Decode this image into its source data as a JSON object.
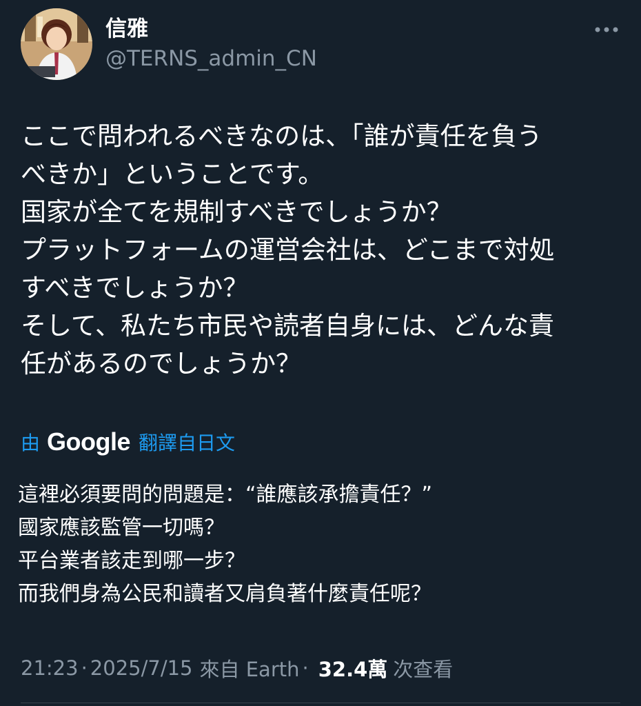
{
  "author": {
    "display_name": "信雅",
    "handle": "@TERNS_admin_CN"
  },
  "tweet": {
    "text": "ここで問われるべきなのは、「誰が責任を負う\nべきか」ということです。\n国家が全てを規制すべきでしょうか？\nプラットフォームの運営会社は、どこまで対処\nすべきでしょうか？\nそして、私たち市民や読者自身には、どんな責\n任があるのでしょうか？"
  },
  "translation": {
    "by_label": "由",
    "provider": "Google",
    "from_label": "翻譯自日文",
    "text": "這裡必須要問的問題是：“誰應該承擔責任？”\n國家應該監管一切嗎？\n平台業者該走到哪一步？\n而我們身為公民和讀者又肩負著什麼責任呢？"
  },
  "meta": {
    "time": "21:23",
    "date": "2025/7/15",
    "source": "來自 Earth",
    "separator": "·",
    "views": "32.4萬",
    "views_label": "次查看"
  },
  "icons": {
    "more": "more-horizontal-icon",
    "avatar": "anime-avatar-image"
  },
  "colors": {
    "background": "#15202b",
    "secondary_text": "#8b98a5",
    "link": "#1d9bf0"
  }
}
